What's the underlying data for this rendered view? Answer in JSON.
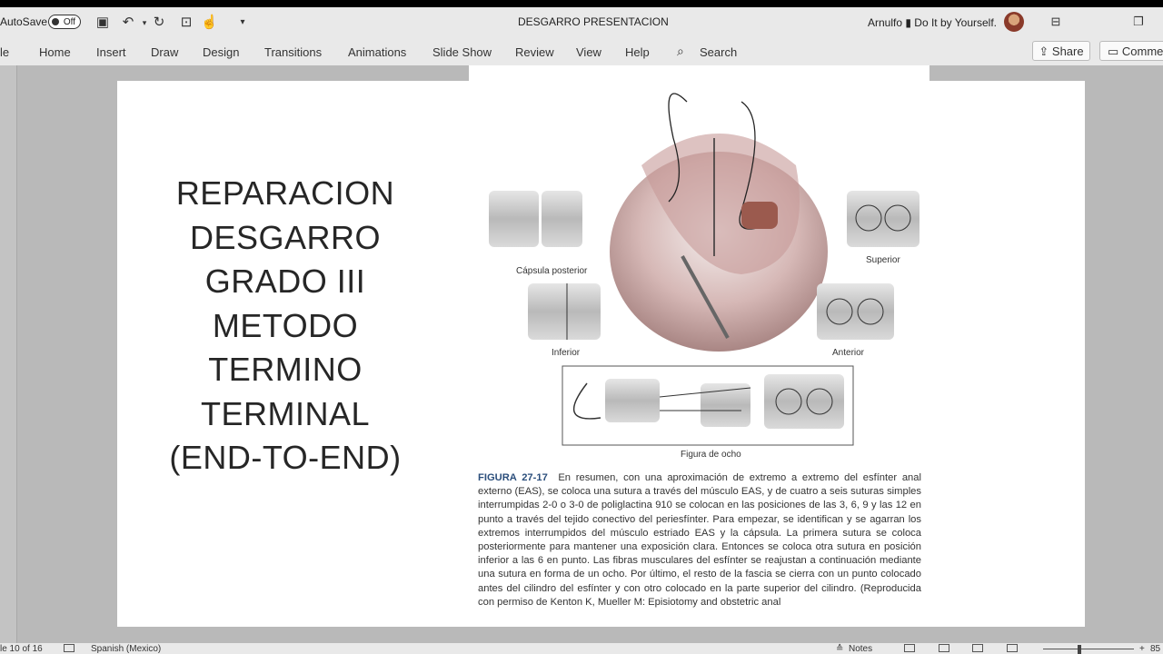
{
  "titlebar": {
    "autosave_label": "AutoSave",
    "autosave_state": "Off",
    "doc_title": "DESGARRO PRESENTACION",
    "user_name": "Arnulfo ▮ Do It by Yourself."
  },
  "ribbon": {
    "tabs": [
      "le",
      "Home",
      "Insert",
      "Draw",
      "Design",
      "Transitions",
      "Animations",
      "Slide Show",
      "Review",
      "View",
      "Help"
    ],
    "search_label": "Search",
    "share_label": "Share",
    "comments_label": "Comme"
  },
  "slide": {
    "title": "REPARACION\nDESGARRO\nGRADO III\nMETODO\nTERMINO\nTERMINAL\n(END-TO-END)",
    "figure": {
      "labels": {
        "capsula": "Cápsula posterior",
        "superior": "Superior",
        "inferior": "Inferior",
        "anterior": "Anterior",
        "figura_ocho": "Figura de ocho"
      },
      "caption_heading": "FIGURA 27-17",
      "caption_body": "En resumen, con una aproximación de extremo a extremo del esfínter anal externo (EAS), se coloca una sutura a través del músculo EAS, y de cuatro a seis suturas simples interrumpidas 2-0 o 3-0 de poliglactina 910 se colocan en las posiciones de las 3, 6, 9 y las 12 en punto a través del tejido conectivo del periesfínter. Para empezar, se identifican y se agarran los extremos interrumpidos del músculo estriado EAS y la cápsula. La primera sutura se coloca posteriormente para mantener una exposición clara. Entonces se coloca otra sutura en posición inferior a las 6 en punto. Las fibras musculares del esfínter se reajustan a continuación mediante una sutura en forma de un ocho. Por último, el resto de la fascia se cierra con un punto colocado antes del cilindro del esfínter y con otro colocado en la parte superior del cilindro. (Reproducida con permiso de Kenton K, Mueller M: Episiotomy and obstetric anal"
    }
  },
  "statusbar": {
    "slide_info": "le 10 of 16",
    "language": "Spanish (Mexico)",
    "notes_label": "Notes",
    "zoom": "85"
  },
  "icons": [
    "save-icon",
    "undo-icon",
    "redo-icon",
    "present-icon",
    "touch-icon",
    "customize-icon",
    "search-icon",
    "share-icon",
    "comment-icon",
    "ribbon-display-icon",
    "restore-icon"
  ]
}
